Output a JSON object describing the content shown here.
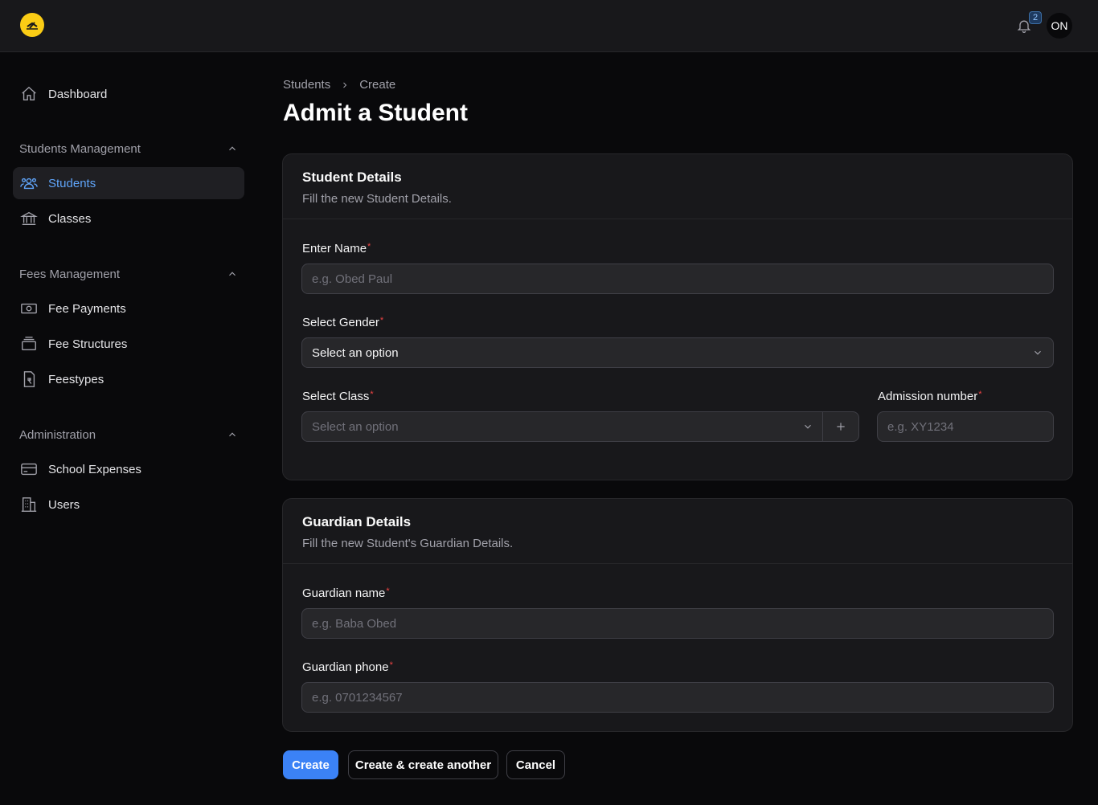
{
  "topbar": {
    "notification_count": "2",
    "avatar_initials": "ON"
  },
  "sidebar": {
    "dashboard": "Dashboard",
    "groups": [
      {
        "label": "Students Management",
        "items": [
          "Students",
          "Classes"
        ]
      },
      {
        "label": "Fees Management",
        "items": [
          "Fee Payments",
          "Fee Structures",
          "Feestypes"
        ]
      },
      {
        "label": "Administration",
        "items": [
          "School Expenses",
          "Users"
        ]
      }
    ],
    "active_item": "Students"
  },
  "breadcrumb": {
    "parent": "Students",
    "current": "Create"
  },
  "page_title": "Admit a Student",
  "student_details": {
    "title": "Student Details",
    "subtitle": "Fill the new Student Details.",
    "name_label": "Enter Name",
    "name_placeholder": "e.g. Obed Paul",
    "gender_label": "Select Gender",
    "gender_value": "Select an option",
    "class_label": "Select Class",
    "class_value": "Select an option",
    "admission_label": "Admission number",
    "admission_placeholder": "e.g. XY1234",
    "required_mark": "*"
  },
  "guardian_details": {
    "title": "Guardian Details",
    "subtitle": "Fill the new Student's Guardian Details.",
    "name_label": "Guardian name",
    "name_placeholder": "e.g. Baba Obed",
    "phone_label": "Guardian phone",
    "phone_placeholder": "e.g. 0701234567",
    "required_mark": "*"
  },
  "actions": {
    "create": "Create",
    "create_another": "Create & create another",
    "cancel": "Cancel"
  },
  "colors": {
    "accent": "#3b82f6",
    "active_nav": "#60a5fa",
    "logo": "#facc15",
    "required": "#ef4444"
  }
}
